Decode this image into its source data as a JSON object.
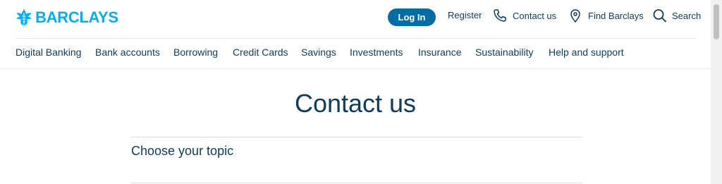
{
  "brand": {
    "name": "BARCLAYS",
    "color": "#00aeef",
    "icon": "eagle-icon"
  },
  "header": {
    "login_label": "Log In",
    "register_label": "Register",
    "contact_label": "Contact us",
    "find_label": "Find Barclays",
    "search_label": "Search"
  },
  "nav": {
    "items": [
      "Digital Banking",
      "Bank accounts",
      "Borrowing",
      "Credit Cards",
      "Savings",
      "Investments",
      "Insurance",
      "Sustainability",
      "Help and support"
    ]
  },
  "main": {
    "title": "Contact us",
    "topic_label": "Choose your topic"
  },
  "colors": {
    "accent": "#006ba4",
    "text": "#0f3a5c"
  }
}
